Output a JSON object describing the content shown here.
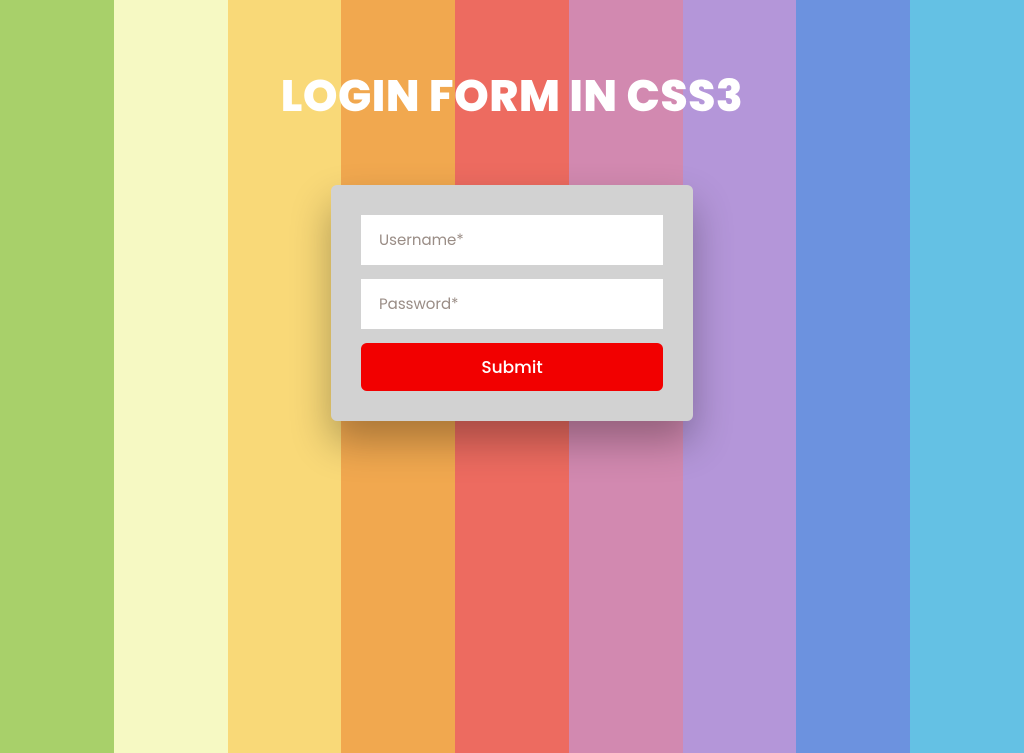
{
  "header": {
    "title": "LOGIN FORM IN CSS3"
  },
  "form": {
    "username_placeholder": "Username*",
    "password_placeholder": "Password*",
    "submit_label": "Submit"
  },
  "background": {
    "stripes": [
      "#a8d06a",
      "#f6f9c3",
      "#f9d978",
      "#f1a84f",
      "#ed6b60",
      "#d289b0",
      "#b496d9",
      "#6c92df",
      "#64c1e4"
    ]
  }
}
